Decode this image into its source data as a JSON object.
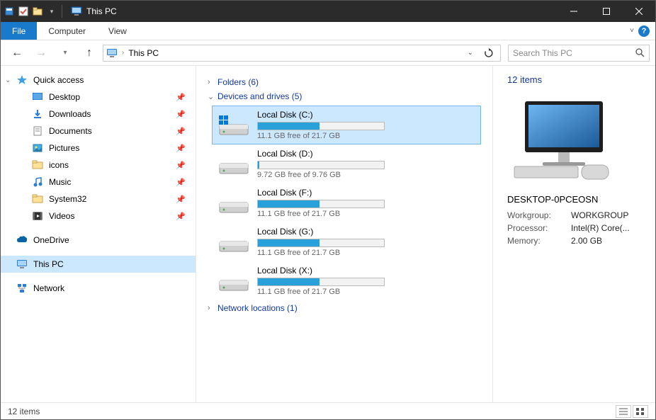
{
  "window": {
    "title": "This PC"
  },
  "ribbon": {
    "file": "File",
    "computer": "Computer",
    "view": "View"
  },
  "address": {
    "crumb": "This PC"
  },
  "search": {
    "placeholder": "Search This PC"
  },
  "sidebar": {
    "quick_access": "Quick access",
    "items": [
      {
        "label": "Desktop",
        "pinned": true
      },
      {
        "label": "Downloads",
        "pinned": true
      },
      {
        "label": "Documents",
        "pinned": true
      },
      {
        "label": "Pictures",
        "pinned": true
      },
      {
        "label": "icons",
        "pinned": true
      },
      {
        "label": "Music",
        "pinned": true
      },
      {
        "label": "System32",
        "pinned": true
      },
      {
        "label": "Videos",
        "pinned": true
      }
    ],
    "onedrive": "OneDrive",
    "thispc": "This PC",
    "network": "Network"
  },
  "groups": {
    "folders": "Folders (6)",
    "drives_header": "Devices and drives (5)",
    "netloc": "Network locations (1)"
  },
  "drives": [
    {
      "name": "Local Disk (C:)",
      "free": "11.1 GB free of 21.7 GB",
      "pct": 49,
      "os": true
    },
    {
      "name": "Local Disk (D:)",
      "free": "9.72 GB free of 9.76 GB",
      "pct": 1,
      "os": false
    },
    {
      "name": "Local Disk (F:)",
      "free": "11.1 GB free of 21.7 GB",
      "pct": 49,
      "os": false
    },
    {
      "name": "Local Disk (G:)",
      "free": "11.1 GB free of 21.7 GB",
      "pct": 49,
      "os": false
    },
    {
      "name": "Local Disk (X:)",
      "free": "11.1 GB free of 21.7 GB",
      "pct": 49,
      "os": false
    }
  ],
  "details": {
    "count": "12 items",
    "name": "DESKTOP-0PCEOSN",
    "rows": [
      {
        "k": "Workgroup:",
        "v": "WORKGROUP"
      },
      {
        "k": "Processor:",
        "v": "Intel(R) Core(..."
      },
      {
        "k": "Memory:",
        "v": "2.00 GB"
      }
    ]
  },
  "status": {
    "text": "12 items"
  }
}
